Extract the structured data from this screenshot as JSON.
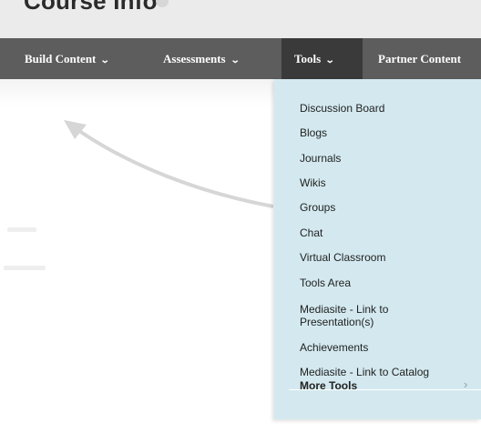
{
  "header": {
    "title": "Course Info"
  },
  "navbar": {
    "items": [
      {
        "label": "Build Content",
        "chevron": "⌄"
      },
      {
        "label": "Assessments",
        "chevron": "⌄"
      },
      {
        "label": "Tools",
        "chevron": "⌄",
        "active": true
      },
      {
        "label": "Partner Content"
      }
    ]
  },
  "tools_menu": {
    "items": [
      "Discussion Board",
      "Blogs",
      "Journals",
      "Wikis",
      "Groups",
      "Chat",
      "Virtual Classroom",
      "Tools Area",
      "Mediasite - Link to Presentation(s)",
      "Achievements",
      "Mediasite - Link to Catalog"
    ],
    "more_label": "More Tools",
    "more_icon": "chevron-right-icon"
  },
  "colors": {
    "navbar_bg": "#5d5d5d",
    "nav_active_bg": "#3a3a3a",
    "menu_bg": "#d3e9ef"
  }
}
